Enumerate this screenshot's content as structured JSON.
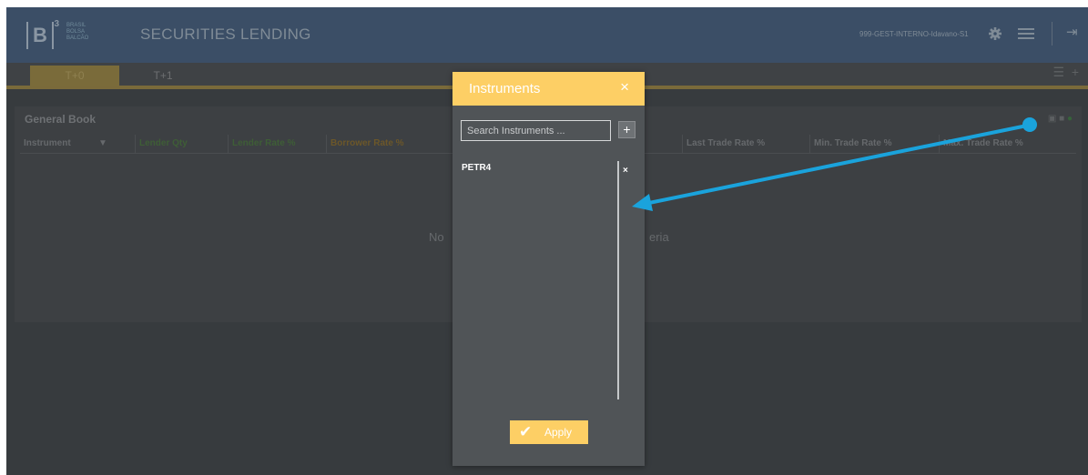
{
  "header": {
    "logo_mark": "B",
    "logo_sup": "3",
    "logo_words": [
      "BRASIL",
      "BOLSA",
      "BALCÃO"
    ],
    "app_title": "SECURITIES LENDING",
    "user_label": "999-GEST-INTERNO-Idavano-S1"
  },
  "icons": {
    "settings": "gear-icon",
    "menu": "hamburger-icon",
    "logout": "logout-icon",
    "add_tab": "plus-icon",
    "columns": "columns-icon",
    "filter": "filter-icon",
    "close": "close-icon",
    "check": "check-icon"
  },
  "tabs": [
    {
      "label": "T+0",
      "active": true
    },
    {
      "label": "T+1",
      "active": false
    }
  ],
  "book": {
    "title": "General Book",
    "columns": [
      {
        "label": "Instrument",
        "tone": "neutral"
      },
      {
        "label": "Lender Qty",
        "tone": "green"
      },
      {
        "label": "Lender Rate %",
        "tone": "green"
      },
      {
        "label": "Borrower Rate %",
        "tone": "orange"
      },
      {
        "label": "Last Trade Rate %",
        "tone": "neutral"
      },
      {
        "label": "Min. Trade Rate %",
        "tone": "neutral"
      },
      {
        "label": "Max. Trade Rate %",
        "tone": "neutral"
      }
    ],
    "empty_left": "No",
    "empty_right": "eria"
  },
  "modal": {
    "title": "Instruments",
    "close_glyph": "×",
    "search_placeholder": "Search Instruments ...",
    "add_glyph": "+",
    "items": [
      "PETR4"
    ],
    "remove_glyph": "×",
    "apply_label": "Apply"
  },
  "colors": {
    "header_bg": "#3b4e66",
    "modal_accent": "#fdcf65",
    "modal_bg": "#505457",
    "annotation_arrow": "#1aa3dc",
    "overlay_bg": "#373b3e"
  }
}
